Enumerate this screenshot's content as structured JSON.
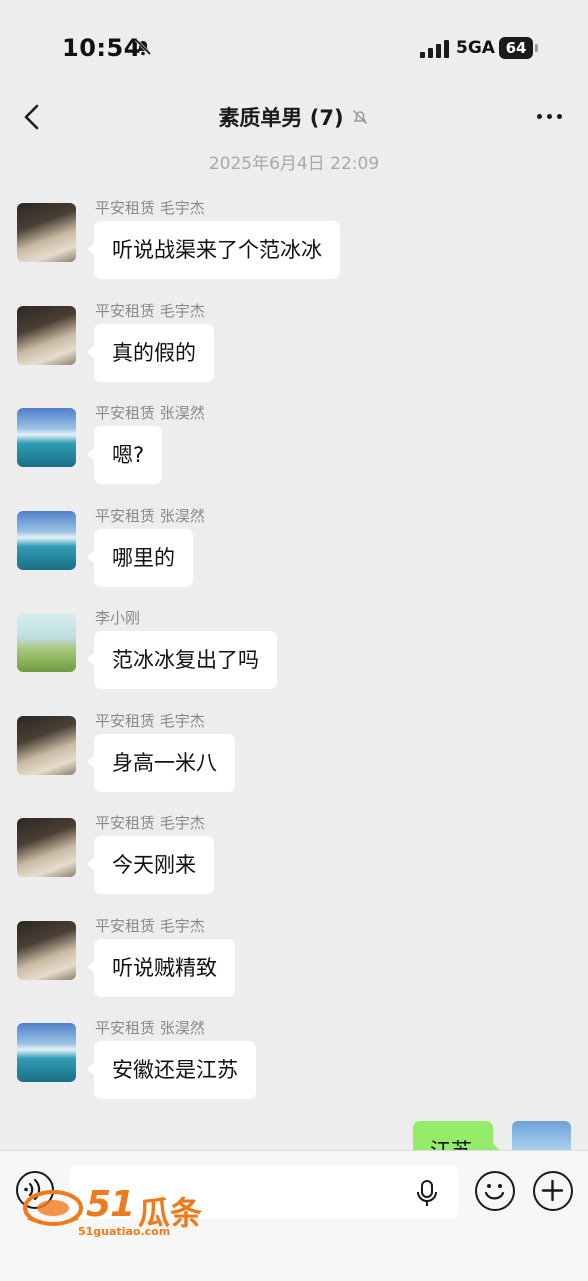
{
  "status_bar": {
    "time": "10:54",
    "network": "5GA",
    "battery": "64"
  },
  "nav": {
    "title": "素质单男 (7)"
  },
  "date_divider": "2025年6月4日 22:09",
  "messages": [
    {
      "sender": "平安租赁 毛宇杰",
      "text": "听说战渠来了个范冰冰",
      "avatar": "cat"
    },
    {
      "sender": "平安租赁 毛宇杰",
      "text": "真的假的",
      "avatar": "cat"
    },
    {
      "sender": "平安租赁 张淏然",
      "text": "嗯?",
      "avatar": "lake"
    },
    {
      "sender": "平安租赁 张淏然",
      "text": "哪里的",
      "avatar": "lake"
    },
    {
      "sender": "李小刚",
      "text": "范冰冰复出了吗",
      "avatar": "field"
    },
    {
      "sender": "平安租赁 毛宇杰",
      "text": "身高一米八",
      "avatar": "cat"
    },
    {
      "sender": "平安租赁 毛宇杰",
      "text": "今天刚来",
      "avatar": "cat"
    },
    {
      "sender": "平安租赁 毛宇杰",
      "text": "听说贼精致",
      "avatar": "cat"
    },
    {
      "sender": "平安租赁 张淏然",
      "text": "安徽还是江苏",
      "avatar": "lake"
    }
  ],
  "own_message": {
    "text": "江苏"
  },
  "watermark": {
    "number": "51",
    "name": "瓜条",
    "url": "51guatiao.com"
  },
  "icons": [
    "back-arrow-icon",
    "bell-off-icon",
    "more-icon",
    "voice-icon",
    "mic-icon",
    "emoji-icon",
    "plus-icon"
  ]
}
